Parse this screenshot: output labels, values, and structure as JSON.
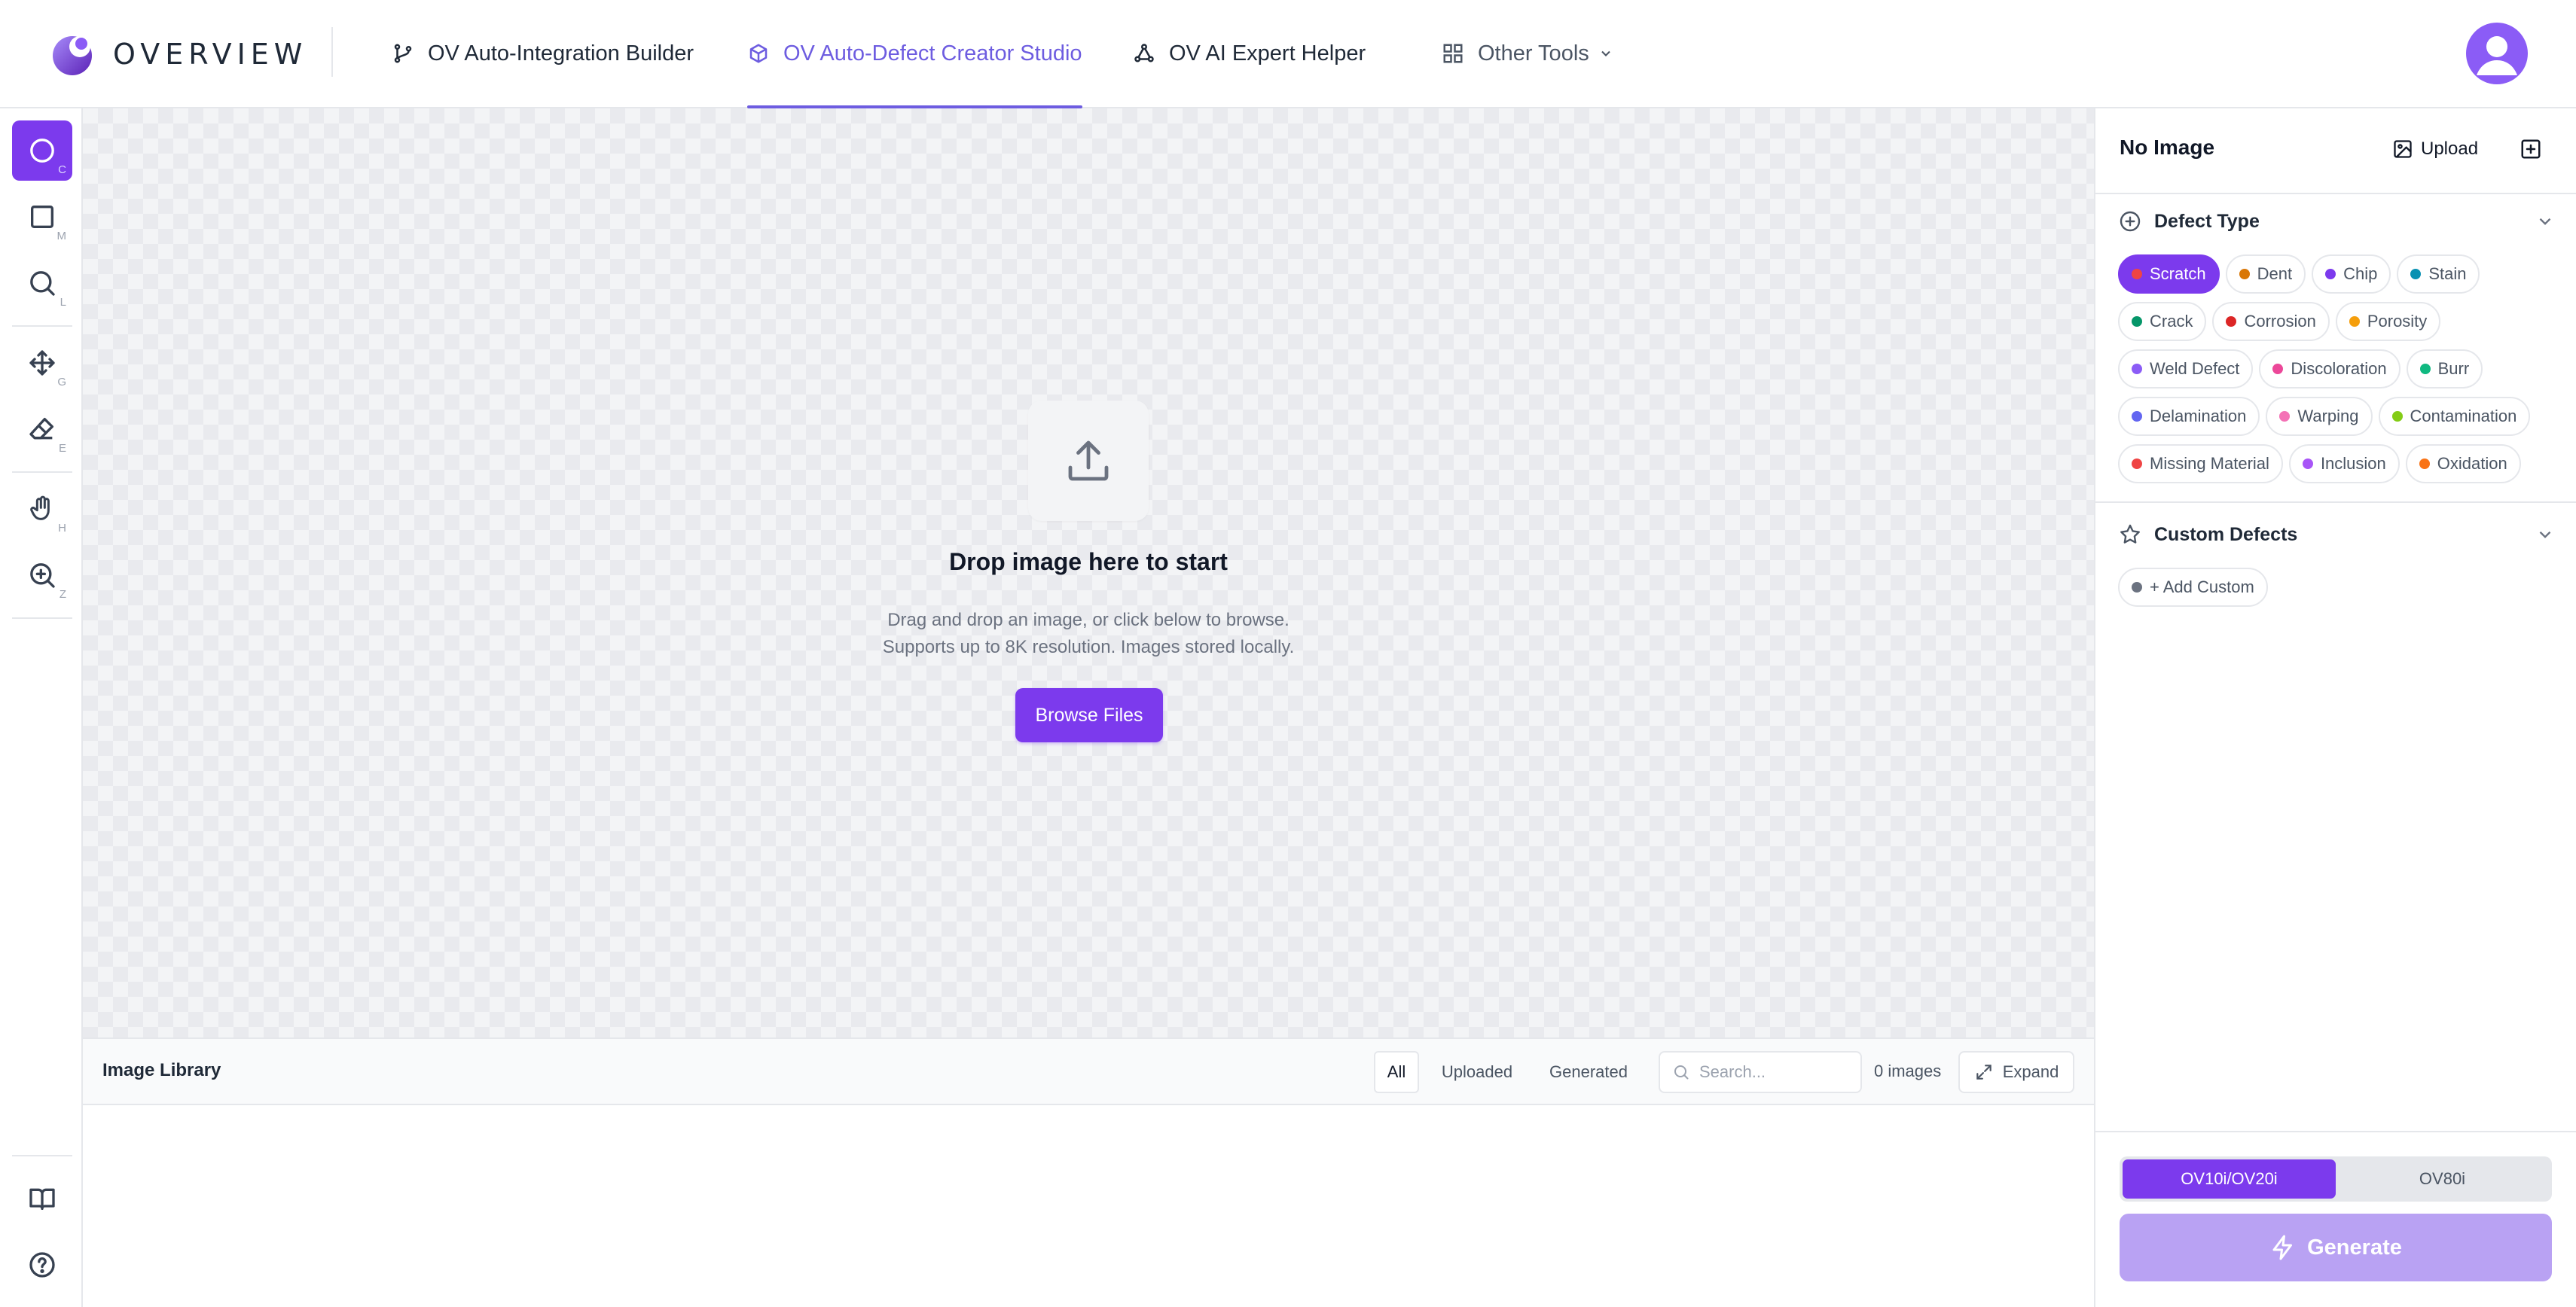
{
  "brand": {
    "name": "OVERVIEW",
    "accent": "#7c3aed"
  },
  "nav": {
    "tabs": [
      {
        "label": "OV Auto-Integration Builder",
        "icon": "git-branch-icon"
      },
      {
        "label": "OV Auto-Defect Creator Studio",
        "icon": "cube-icon",
        "active": true
      },
      {
        "label": "OV AI Expert Helper",
        "icon": "network-icon"
      }
    ],
    "other_tools": "Other Tools"
  },
  "tools": [
    {
      "name": "circle-tool",
      "key": "C",
      "active": true
    },
    {
      "name": "rectangle-tool",
      "key": "M"
    },
    {
      "name": "lasso-tool",
      "key": "L"
    },
    {
      "name": "move-tool",
      "key": "G"
    },
    {
      "name": "eraser-tool",
      "key": "E"
    },
    {
      "name": "hand-tool",
      "key": "H"
    },
    {
      "name": "zoom-tool",
      "key": "Z"
    }
  ],
  "dropzone": {
    "title": "Drop image here to start",
    "line1": "Drag and drop an image, or click below to browse.",
    "line2": "Supports up to 8K resolution. Images stored locally.",
    "button": "Browse Files"
  },
  "library": {
    "title": "Image Library",
    "filters": [
      "All",
      "Uploaded",
      "Generated"
    ],
    "search_placeholder": "Search...",
    "count": "0 images",
    "expand": "Expand"
  },
  "panel": {
    "title": "No Image",
    "upload": "Upload",
    "defect_type_label": "Defect Type",
    "custom_label": "Custom Defects",
    "add_custom": "+ Add Custom",
    "defects": [
      {
        "label": "Scratch",
        "color": "#ef4444",
        "active": true
      },
      {
        "label": "Dent",
        "color": "#d97706"
      },
      {
        "label": "Chip",
        "color": "#7c3aed"
      },
      {
        "label": "Stain",
        "color": "#0891b2"
      },
      {
        "label": "Crack",
        "color": "#059669"
      },
      {
        "label": "Corrosion",
        "color": "#dc2626"
      },
      {
        "label": "Porosity",
        "color": "#f59e0b"
      },
      {
        "label": "Weld Defect",
        "color": "#8b5cf6"
      },
      {
        "label": "Discoloration",
        "color": "#ec4899"
      },
      {
        "label": "Burr",
        "color": "#10b981"
      },
      {
        "label": "Delamination",
        "color": "#6366f1"
      },
      {
        "label": "Warping",
        "color": "#f472b6"
      },
      {
        "label": "Contamination",
        "color": "#84cc16"
      },
      {
        "label": "Missing Material",
        "color": "#ef4444"
      },
      {
        "label": "Inclusion",
        "color": "#a855f7"
      },
      {
        "label": "Oxidation",
        "color": "#f97316"
      }
    ],
    "models": [
      {
        "label": "OV10i/OV20i",
        "active": true
      },
      {
        "label": "OV80i"
      }
    ],
    "generate": "Generate"
  }
}
